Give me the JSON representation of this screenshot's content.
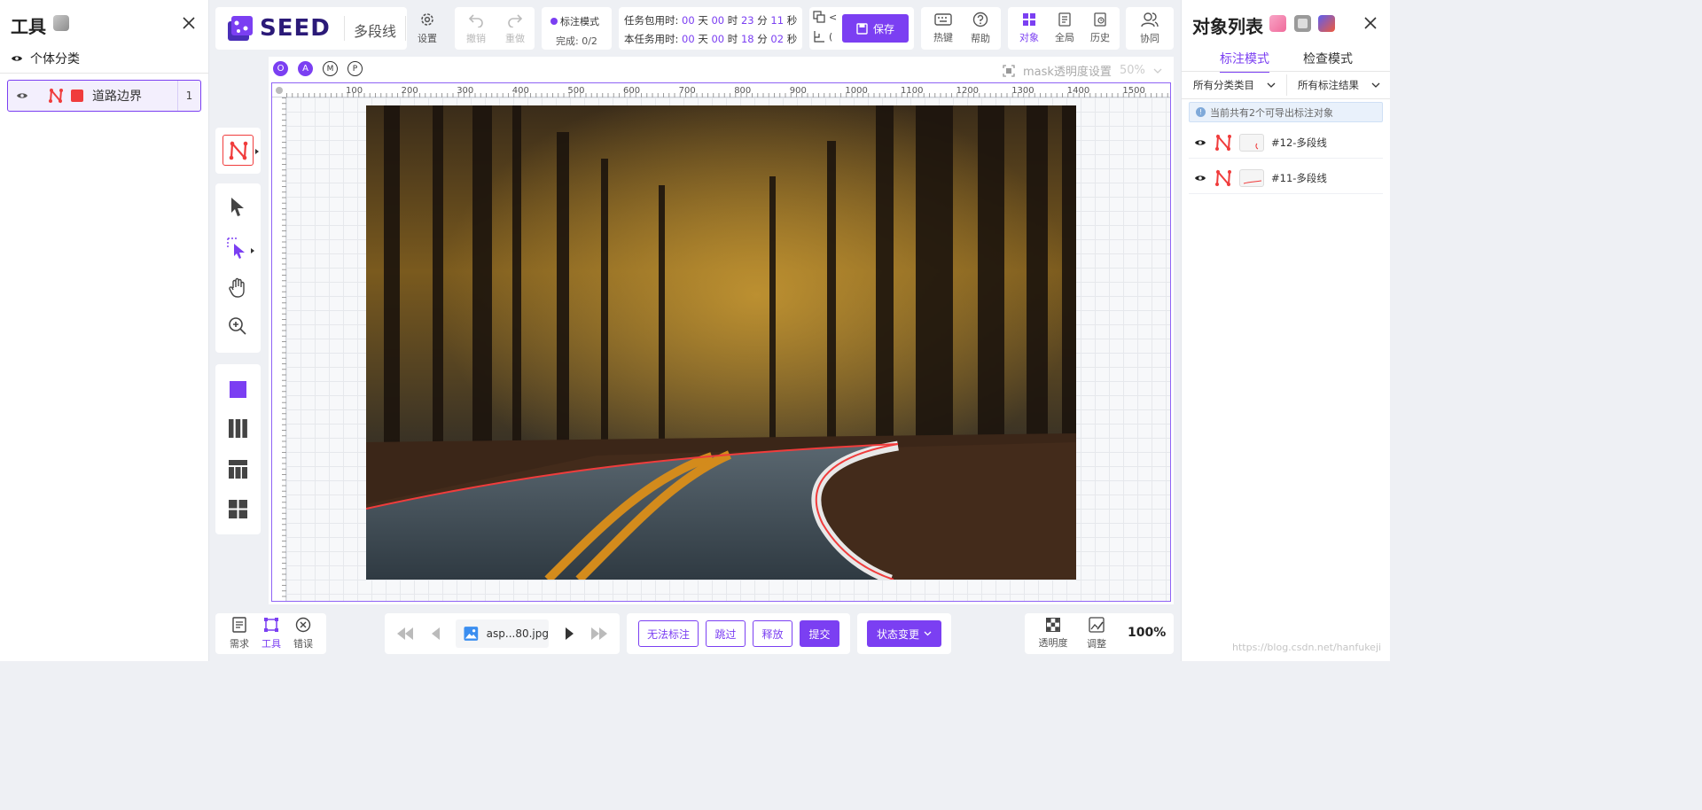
{
  "left_panel": {
    "title": "工具",
    "close_icon": "close-icon",
    "subheading": "个体分类",
    "category": {
      "label": "道路边界",
      "count": "1",
      "color": "#f03c3c"
    }
  },
  "brand": {
    "logo_text": "SEED",
    "tool_name": "多段线"
  },
  "toolbar": {
    "settings": "设置",
    "undo": "撤销",
    "redo": "重做",
    "mode_label": "标注模式",
    "progress": "完成: 0/2",
    "task_total": {
      "label": "任务包用时:",
      "d": "00",
      "h": "00",
      "m": "23",
      "s": "11",
      "u_d": "天",
      "u_h": "时",
      "u_m": "分",
      "u_s": "秒"
    },
    "task_this": {
      "label": "本任务用时:",
      "d": "00",
      "h": "00",
      "m": "18",
      "s": "02",
      "u_d": "天",
      "u_h": "时",
      "u_m": "分",
      "u_s": "秒"
    },
    "paren1": "<",
    "paren2": "(",
    "save": "保存",
    "hotkeys": "热键",
    "help": "帮助",
    "objects": "对象",
    "global": "全局",
    "history": "历史",
    "collab": "协同"
  },
  "canvas": {
    "mode_badges": [
      "O",
      "A",
      "M",
      "P"
    ],
    "mask_label": "mask透明度设置",
    "mask_value": "50%",
    "ruler_x": [
      "100",
      "200",
      "300",
      "400",
      "500",
      "600",
      "700",
      "800",
      "900",
      "1000",
      "1100",
      "1200",
      "1300",
      "1400",
      "1500"
    ],
    "ruler_y": [
      "0",
      "100",
      "200",
      "300",
      "400",
      "500",
      "600",
      "700",
      "800"
    ]
  },
  "bottom": {
    "requirements": "需求",
    "tools": "工具",
    "errors": "错误",
    "filename": "asp...80.jpg",
    "cannot_label": "无法标注",
    "skip": "跳过",
    "release": "释放",
    "submit": "提交",
    "status_change": "状态变更",
    "transparency": "透明度",
    "adjust": "调整",
    "zoom": "100%",
    "watermark": "https://blog.csdn.net/hanfukeji"
  },
  "right_panel": {
    "title": "对象列表",
    "tab_annotate": "标注模式",
    "tab_check": "检查模式",
    "filter_category": "所有分类类目",
    "filter_result": "所有标注结果",
    "info": "当前共有2个可导出标注对象",
    "objects": [
      {
        "label": "#12-多段线"
      },
      {
        "label": "#11-多段线"
      }
    ]
  }
}
